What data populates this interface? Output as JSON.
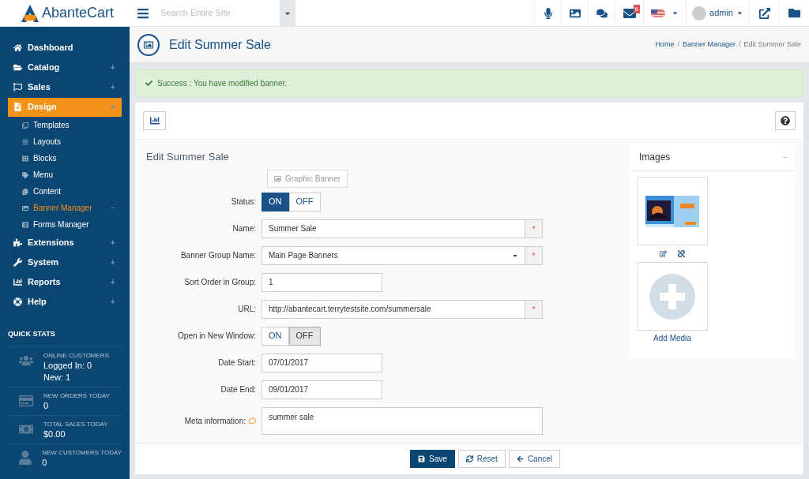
{
  "topbar": {
    "logo": "AbanteCart",
    "search": {
      "placeholder": "Search Entire Site"
    },
    "mail_badge": "6",
    "user": "admin"
  },
  "sidebar": {
    "items": [
      {
        "label": "Dashboard",
        "selected": false
      },
      {
        "label": "Catalog",
        "selected": false,
        "toggle": "+"
      },
      {
        "label": "Sales",
        "selected": false,
        "toggle": "+"
      },
      {
        "label": "Design",
        "selected": true,
        "toggle": "+",
        "children": [
          {
            "label": "Templates",
            "selected": false
          },
          {
            "label": "Layouts",
            "selected": false
          },
          {
            "label": "Blocks",
            "selected": false
          },
          {
            "label": "Menu",
            "selected": false
          },
          {
            "label": "Content",
            "selected": false
          },
          {
            "label": "Banner Manager",
            "selected": true,
            "toggle": "−"
          },
          {
            "label": "Forms Manager",
            "selected": false
          }
        ]
      },
      {
        "label": "Extensions",
        "selected": false,
        "toggle": "+"
      },
      {
        "label": "System",
        "selected": false,
        "toggle": "+"
      },
      {
        "label": "Reports",
        "selected": false,
        "toggle": "+"
      },
      {
        "label": "Help",
        "selected": false,
        "toggle": "+"
      }
    ],
    "quick_stats": {
      "title": "QUICK STATS",
      "stats": [
        {
          "label": "ONLINE CUSTOMERS",
          "values": [
            "Logged In: 0",
            "New: 1"
          ]
        },
        {
          "label": "NEW ORDERS TODAY",
          "values": [
            "0"
          ]
        },
        {
          "label": "TOTAL SALES TODAY",
          "values": [
            "$0.00"
          ]
        },
        {
          "label": "NEW CUSTOMERS TODAY",
          "values": [
            "0"
          ]
        }
      ]
    }
  },
  "page": {
    "title": "Edit Summer Sale",
    "breadcrumbs": [
      {
        "label": "Home",
        "link": true
      },
      {
        "separator": "/",
        "label": "Banner Manager",
        "link": true
      },
      {
        "separator": "/",
        "label": "Edit Summer Sale",
        "link": false
      }
    ]
  },
  "alert": "Success : You have modified banner.",
  "form": {
    "title": "Edit Summer Sale",
    "type_button": "Graphic Banner",
    "fields": [
      {
        "kind": "toggle",
        "label": "Status:",
        "options": [
          {
            "label": "ON",
            "selected": true
          },
          {
            "label": "OFF",
            "selected": false
          }
        ]
      },
      {
        "kind": "text",
        "label": "Name:",
        "value": "Summer Sale",
        "required_mark": "*"
      },
      {
        "kind": "select",
        "label": "Banner Group Name:",
        "value": "Main Page Banners",
        "required_mark": "*"
      },
      {
        "kind": "short",
        "label": "Sort Order in Group:",
        "value": "1"
      },
      {
        "kind": "text",
        "label": "URL:",
        "value": "http://abantecart.terrytestsite.com/summersale",
        "required_mark": "*"
      },
      {
        "kind": "toggle",
        "label": "Open in New Window:",
        "options": [
          {
            "label": "ON",
            "selected": false
          },
          {
            "label": "OFF",
            "selected": true
          }
        ]
      },
      {
        "kind": "short",
        "label": "Date Start:",
        "value": "07/01/2017"
      },
      {
        "kind": "short",
        "label": "Date End:",
        "value": "09/01/2017"
      },
      {
        "kind": "textarea",
        "label": "Meta information:",
        "value": "summer sale",
        "hint": true
      }
    ],
    "buttons": [
      {
        "label": "Save",
        "primary": true
      },
      {
        "label": "Reset",
        "primary": false
      },
      {
        "label": "Cancel",
        "primary": false
      }
    ]
  },
  "images": {
    "title": "Images",
    "collapse": "−",
    "add_label": "Add Media"
  }
}
